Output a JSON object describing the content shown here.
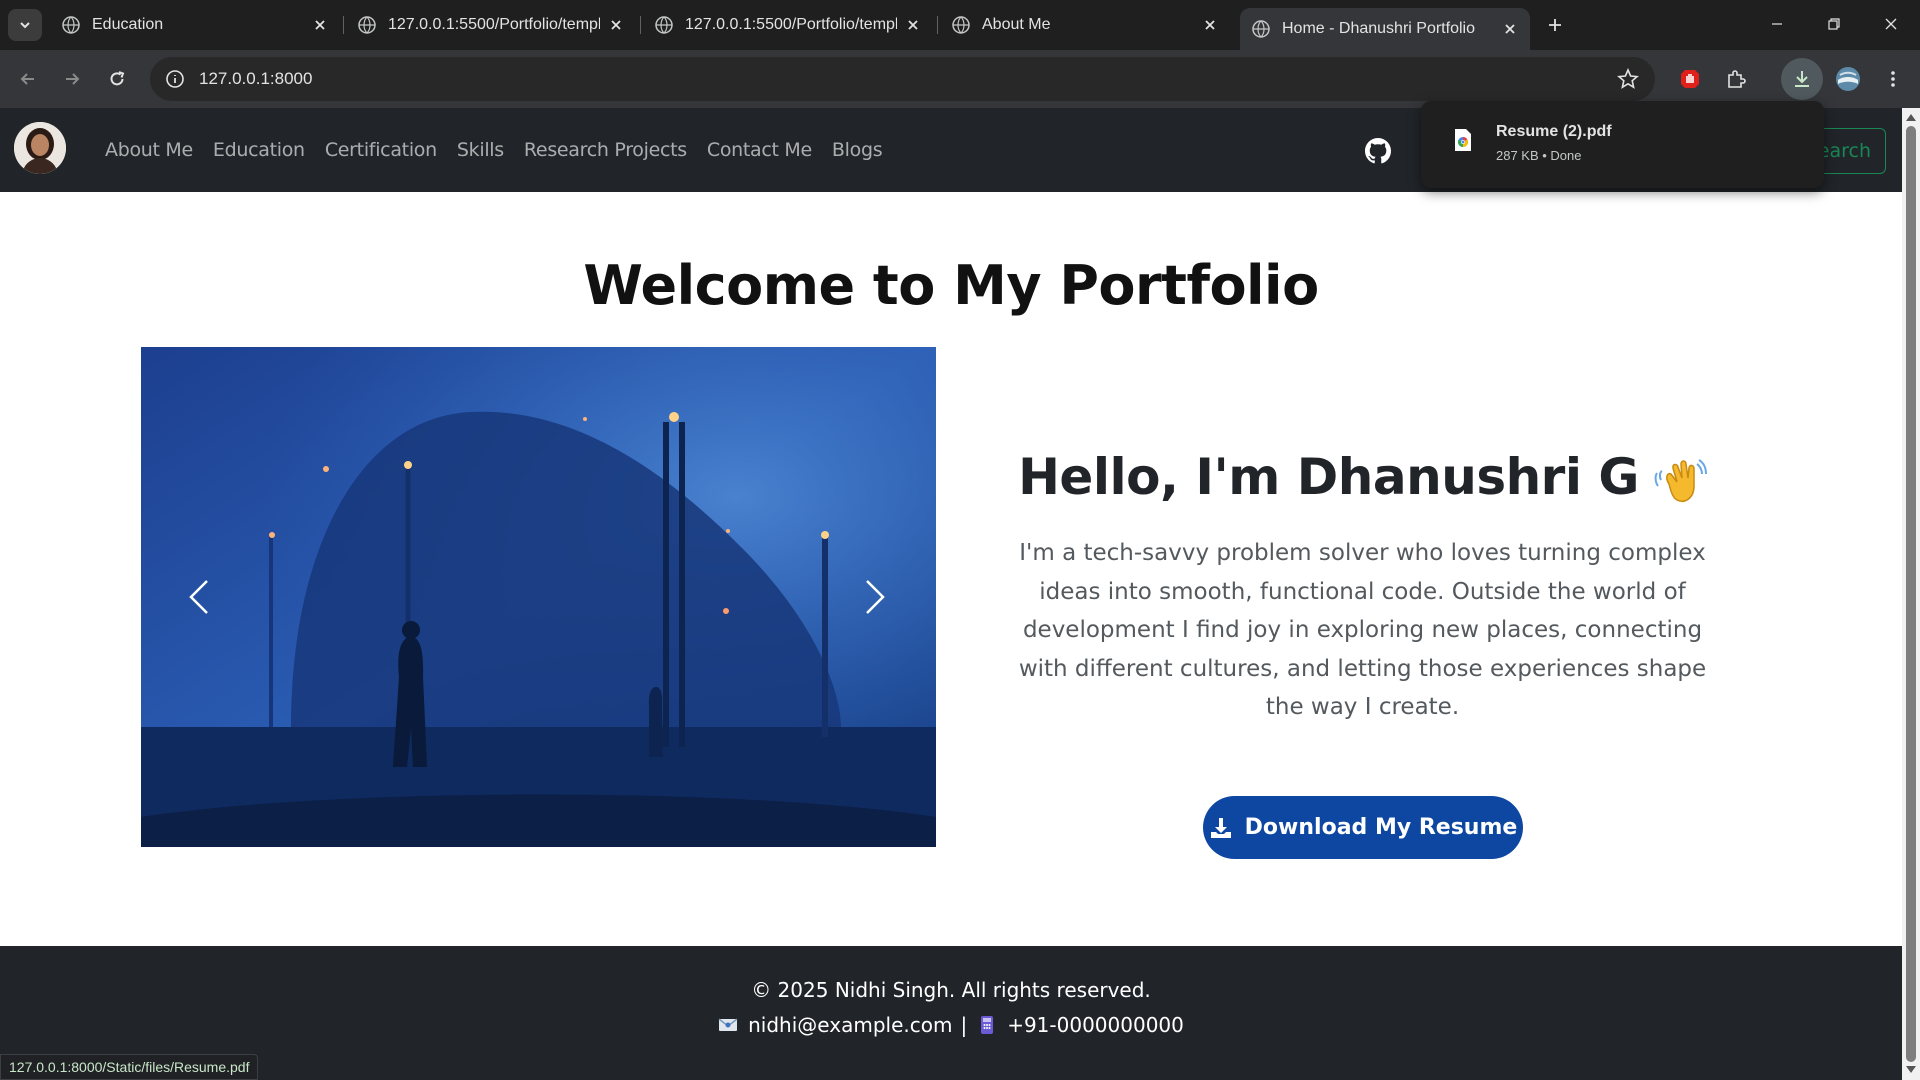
{
  "browser": {
    "tabs": [
      {
        "title": "Education",
        "active": false
      },
      {
        "title": "127.0.0.1:5500/Portfolio/templa",
        "active": false
      },
      {
        "title": "127.0.0.1:5500/Portfolio/templa",
        "active": false
      },
      {
        "title": "About Me",
        "active": false
      },
      {
        "title": "Home - Dhanushri Portfolio",
        "active": true
      }
    ],
    "url": "127.0.0.1:8000",
    "status_url": "127.0.0.1:8000/Static/files/Resume.pdf"
  },
  "download": {
    "filename": "Resume (2).pdf",
    "meta": "287 KB • Done"
  },
  "site_nav": {
    "links": [
      "About Me",
      "Education",
      "Certification",
      "Skills",
      "Research Projects",
      "Contact Me",
      "Blogs"
    ],
    "search_label": "earch"
  },
  "hero": {
    "title": "Welcome to My Portfolio",
    "hello": "Hello, I'm Dhanushri G",
    "intro": "I'm a tech-savvy problem solver who loves turning complex ideas into smooth, functional code. Outside the world of development I find joy in exploring new places, connecting with different cultures, and letting those experiences shape the way I create.",
    "resume_button": "Download My Resume"
  },
  "footer": {
    "copyright": "© 2025 Nidhi Singh. All rights reserved.",
    "email": "nidhi@example.com",
    "separator": "|",
    "phone": "+91-0000000000"
  },
  "colors": {
    "nav_bg": "#212529",
    "resume_button": "#0d47a1",
    "search_button": "#198754"
  }
}
